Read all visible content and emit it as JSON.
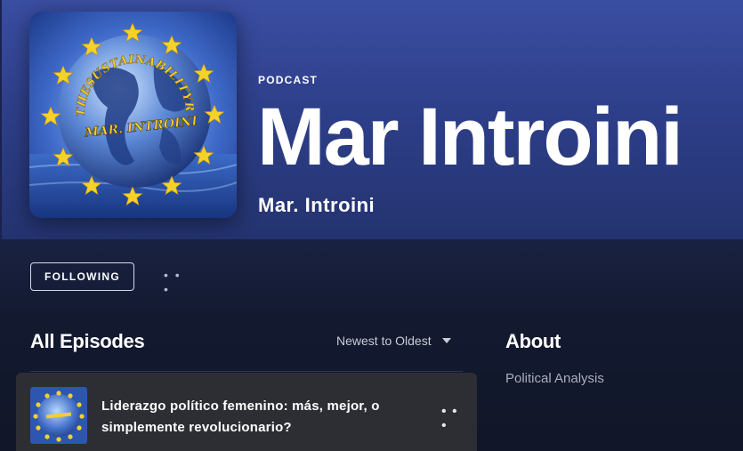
{
  "header": {
    "kind_label": "PODCAST",
    "title": "Mar Introini",
    "author": "Mar. Introini"
  },
  "cover_art": {
    "arc_text": "THESUSTAINABILITYREADER.COM",
    "center_text": "MAR. INTROINI"
  },
  "actions": {
    "follow_label": "FOLLOWING",
    "more_glyph": "• • •"
  },
  "episodes_section": {
    "title": "All Episodes",
    "sort_label": "Newest to Oldest",
    "items": [
      {
        "title": "Liderazgo político femenino: más, mejor, o simplemente revolucionario?",
        "more_glyph": "• • •"
      }
    ]
  },
  "about_section": {
    "title": "About",
    "text": "Political Analysis"
  },
  "colors": {
    "hero_top": "#3a4ea2",
    "hero_bottom": "#24336f",
    "page_bg": "#121728",
    "row_hover": "#2c2e34",
    "star_yellow": "#f5d22a"
  }
}
